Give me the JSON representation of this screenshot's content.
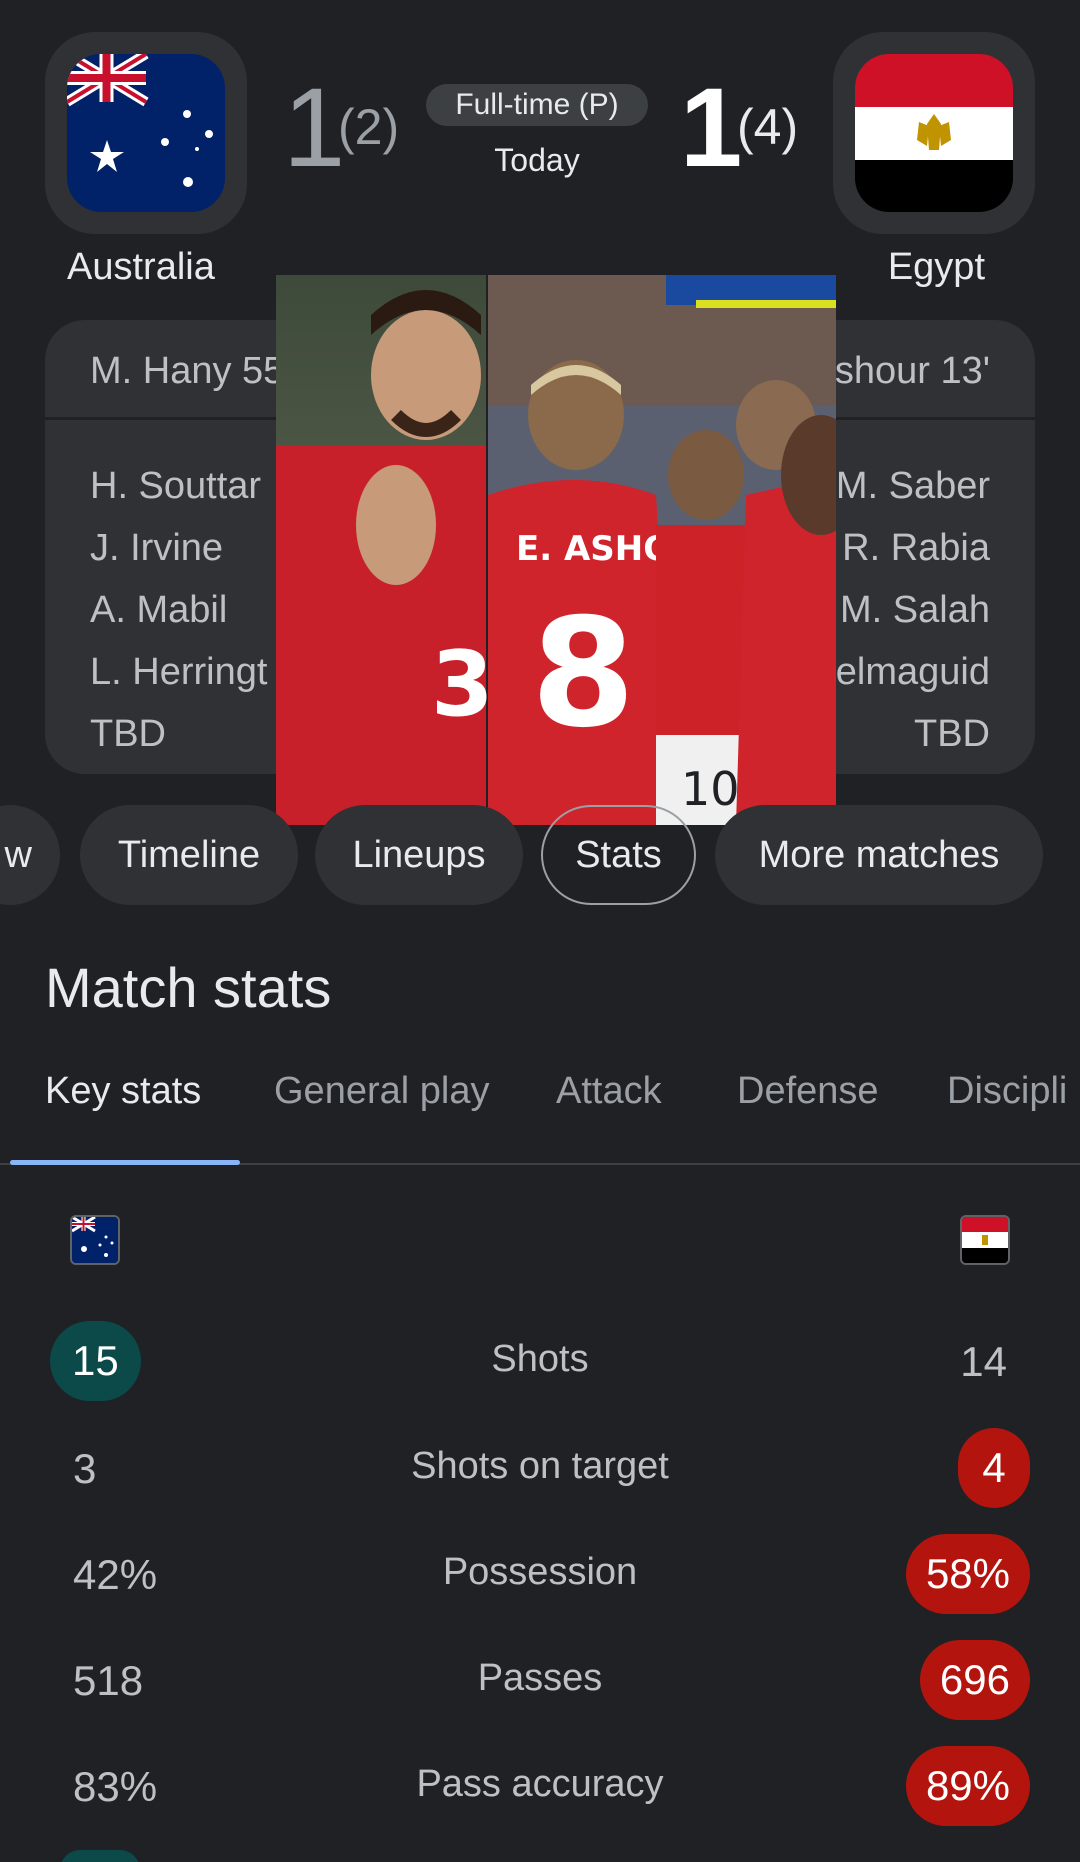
{
  "header": {
    "home": {
      "name": "Australia",
      "score": "1",
      "penalties": "(2)"
    },
    "away": {
      "name": "Egypt",
      "score": "1",
      "penalties": "(4)"
    },
    "status": "Full-time (P)",
    "date": "Today"
  },
  "scorers": {
    "home_goal": "M. Hany 55",
    "away_goal": "shour 13'",
    "home_list": [
      "H. Souttar",
      "J. Irvine",
      "A. Mabil",
      "L. Herringt",
      "TBD"
    ],
    "away_list": [
      "M. Saber",
      "R. Rabia",
      "M. Salah",
      "elmaguid",
      "TBD"
    ]
  },
  "video": {
    "jersey_left_number": "3",
    "jersey_name": "E. ASHOUR",
    "jersey_number": "8",
    "jersey_right_number": "10"
  },
  "tabs": [
    "w",
    "Timeline",
    "Lineups",
    "Stats",
    "More matches"
  ],
  "active_tab": "Stats",
  "stats": {
    "title": "Match stats",
    "subtabs": [
      "Key stats",
      "General play",
      "Attack",
      "Defense",
      "Discipli"
    ],
    "active_subtab": "Key stats",
    "rows": [
      {
        "label": "Shots",
        "home": "15",
        "away": "14",
        "leader": "home"
      },
      {
        "label": "Shots on target",
        "home": "3",
        "away": "4",
        "leader": "away"
      },
      {
        "label": "Possession",
        "home": "42%",
        "away": "58%",
        "leader": "away"
      },
      {
        "label": "Passes",
        "home": "518",
        "away": "696",
        "leader": "away"
      },
      {
        "label": "Pass accuracy",
        "home": "83%",
        "away": "89%",
        "leader": "away"
      }
    ]
  },
  "colors": {
    "home_leader_pill": "#0b4a48",
    "away_leader_pill": "#b3150e",
    "tab_underline": "#8ab4f8"
  }
}
